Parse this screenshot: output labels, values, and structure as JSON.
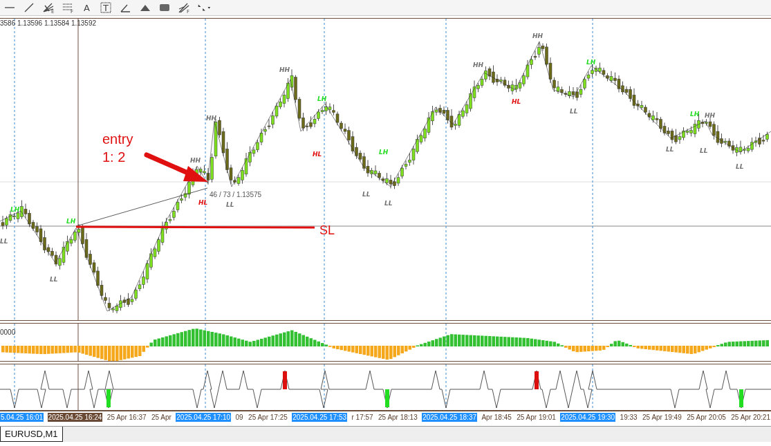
{
  "toolbar": {
    "tools": [
      {
        "kind": "hline"
      },
      {
        "kind": "trendline"
      },
      {
        "kind": "fan",
        "letter": "E"
      },
      {
        "kind": "fib",
        "letter": "F"
      },
      {
        "kind": "text",
        "letter": "A"
      },
      {
        "kind": "label",
        "letter": "T"
      },
      {
        "kind": "angle"
      },
      {
        "kind": "triangle"
      },
      {
        "kind": "rectangle"
      },
      {
        "kind": "pitchfork",
        "letter": "F"
      },
      {
        "kind": "arrows"
      }
    ]
  },
  "chart": {
    "ohlc": "3586 1.13596 1.13584 1.13592",
    "entry_note": [
      "entry",
      "1: 2"
    ],
    "stop_label": "SL",
    "measure": "46 / 73 / 1.13575",
    "swing_labels": [
      {
        "text": "LH",
        "color": "#22dd22"
      },
      {
        "text": "LL",
        "color": "#707070"
      },
      {
        "text": "LH",
        "color": "#22dd22"
      },
      {
        "text": "LL",
        "color": "#707070"
      },
      {
        "text": "HH",
        "color": "#707070"
      },
      {
        "text": "HH",
        "color": "#707070"
      },
      {
        "text": "HL",
        "color": "#e01010"
      },
      {
        "text": "LL",
        "color": "#707070"
      },
      {
        "text": "HH",
        "color": "#707070"
      },
      {
        "text": "LH",
        "color": "#22dd22"
      },
      {
        "text": "HL",
        "color": "#e01010"
      },
      {
        "text": "LH",
        "color": "#22dd22"
      },
      {
        "text": "LL",
        "color": "#707070"
      },
      {
        "text": "LL",
        "color": "#707070"
      },
      {
        "text": "HH",
        "color": "#707070"
      },
      {
        "text": "HL",
        "color": "#e01010"
      },
      {
        "text": "HH",
        "color": "#707070"
      },
      {
        "text": "LH",
        "color": "#22dd22"
      },
      {
        "text": "LL",
        "color": "#707070"
      },
      {
        "text": "LL",
        "color": "#707070"
      },
      {
        "text": "LH",
        "color": "#22dd22"
      },
      {
        "text": "HH",
        "color": "#707070"
      },
      {
        "text": "LL",
        "color": "#707070"
      },
      {
        "text": "LL",
        "color": "#707070"
      }
    ]
  },
  "oscillator": {
    "value": "0000"
  },
  "time_axis": [
    {
      "text": "5.04.25 16:01",
      "kind": "highlight"
    },
    {
      "text": "2025.04.25 16:24",
      "kind": "cursor"
    },
    {
      "text": "25 Apr 16:37",
      "kind": "plain"
    },
    {
      "text": "25 Apr",
      "kind": "plain"
    },
    {
      "text": "2025.04.25 17:10",
      "kind": "highlight"
    },
    {
      "text": "09",
      "kind": "plain"
    },
    {
      "text": "25 Apr 17:25",
      "kind": "plain"
    },
    {
      "text": "2025.04.25 17:53",
      "kind": "highlight"
    },
    {
      "text": "r 17:57",
      "kind": "plain"
    },
    {
      "text": "25 Apr 18:13",
      "kind": "plain"
    },
    {
      "text": "2025.04.25 18:37",
      "kind": "highlight"
    },
    {
      "text": "Apr 18:45",
      "kind": "plain"
    },
    {
      "text": "25 Apr 19:01",
      "kind": "plain"
    },
    {
      "text": "2025.04.25 19:30",
      "kind": "highlight"
    },
    {
      "text": "19:33",
      "kind": "plain"
    },
    {
      "text": "25 Apr 19:49",
      "kind": "plain"
    },
    {
      "text": "25 Apr 20:05",
      "kind": "plain"
    },
    {
      "text": "25 Apr 20:21",
      "kind": "plain"
    }
  ],
  "tabs": [
    {
      "label": "EURUSD,M1",
      "selected": true
    }
  ]
}
